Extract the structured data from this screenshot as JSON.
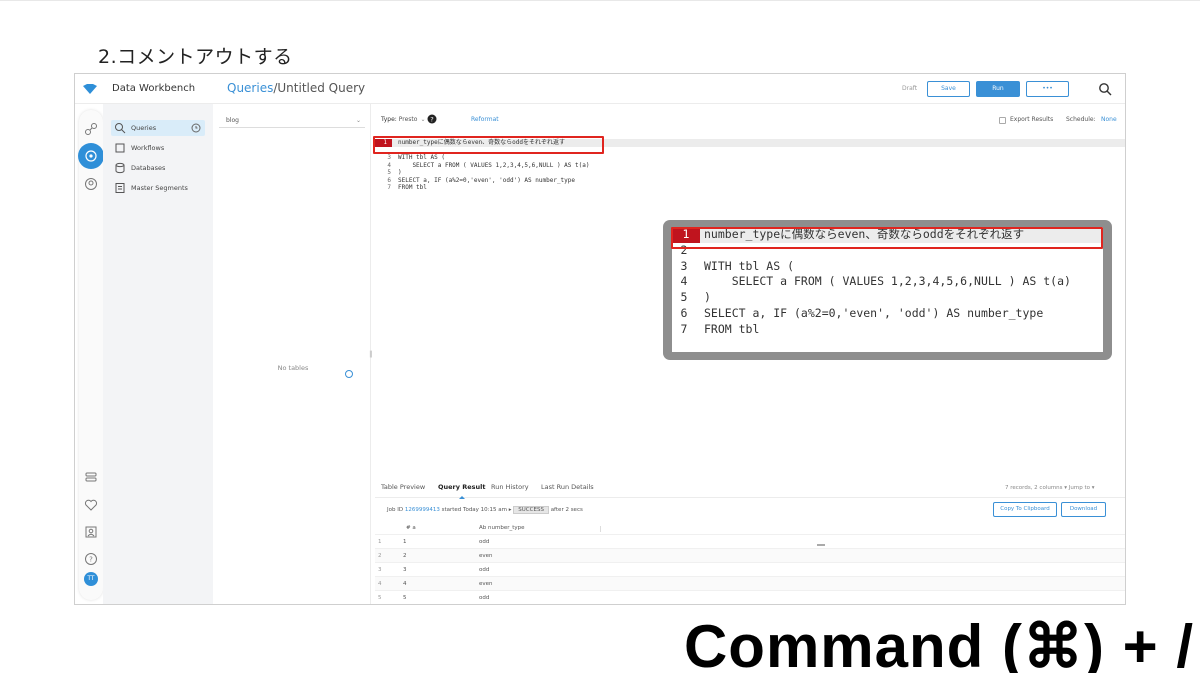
{
  "slide": {
    "title": "2.コメントアウトする",
    "shortcut": "Command (⌘) + /"
  },
  "app": {
    "name": "Data Workbench",
    "breadcrumb": {
      "root": "Queries",
      "separator": "/",
      "current": "Untitled Query"
    },
    "toolbar": {
      "draft": "Draft",
      "save": "Save",
      "run": "Run",
      "more": "•••"
    },
    "accent": "#3a90d6",
    "highlight": "#e0251f"
  },
  "nav": {
    "items": [
      {
        "label": "Queries",
        "icon": "search-icon",
        "selected": true
      },
      {
        "label": "Workflows",
        "icon": "workflow-icon",
        "selected": false
      },
      {
        "label": "Databases",
        "icon": "database-icon",
        "selected": false
      },
      {
        "label": "Master Segments",
        "icon": "segment-icon",
        "selected": false
      }
    ]
  },
  "tables": {
    "database": "blog",
    "empty_text": "No tables"
  },
  "editor": {
    "type_label": "Type:",
    "type_value": "Presto",
    "reformat": "Reformat",
    "export_label": "Export Results",
    "schedule_label": "Schedule:",
    "schedule_value": "None",
    "lines": [
      {
        "n": "1",
        "text": "number_typeに偶数ならeven、奇数ならoddをそれぞれ返す",
        "highlight": true
      },
      {
        "n": "2",
        "text": ""
      },
      {
        "n": "3",
        "text": "WITH tbl AS ("
      },
      {
        "n": "4",
        "text": "    SELECT a FROM ( VALUES 1,2,3,4,5,6,NULL ) AS t(a)"
      },
      {
        "n": "5",
        "text": ")"
      },
      {
        "n": "6",
        "text": "SELECT a, IF (a%2=0,'even', 'odd') AS number_type"
      },
      {
        "n": "7",
        "text": "FROM tbl"
      }
    ]
  },
  "results": {
    "tabs": [
      "Table Preview",
      "Query Result",
      "Run History",
      "Last Run Details"
    ],
    "active_tab": "Query Result",
    "meta": "7 records, 2 columns  ▾  Jump to ▾",
    "job_prefix": "Job ID",
    "job_id": "1269999413",
    "job_started": "started Today 10:15 am  ▸",
    "job_status": "SUCCESS",
    "job_after": "after 2 secs",
    "copy": "Copy To Clipboard",
    "download": "Download",
    "columns": [
      "# a",
      "Ab number_type"
    ],
    "rows": [
      {
        "i": "1",
        "a": "1",
        "t": "odd"
      },
      {
        "i": "2",
        "a": "2",
        "t": "even"
      },
      {
        "i": "3",
        "a": "3",
        "t": "odd"
      },
      {
        "i": "4",
        "a": "4",
        "t": "even"
      },
      {
        "i": "5",
        "a": "5",
        "t": "odd"
      }
    ]
  },
  "user": {
    "initials": "TT"
  }
}
